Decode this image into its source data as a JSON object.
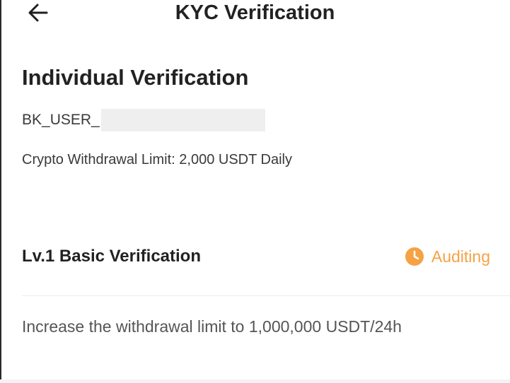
{
  "header": {
    "title": "KYC Verification",
    "back_icon": "arrow-left-icon"
  },
  "main": {
    "section_title": "Individual Verification",
    "user_id_prefix": "BK_USER_",
    "withdraw_limit": "Crypto Withdrawal Limit: 2,000 USDT Daily"
  },
  "level": {
    "title": "Lv.1 Basic Verification",
    "status": "Auditing",
    "status_icon": "clock-icon",
    "status_color": "#f5a245",
    "description": "Increase the withdrawal limit to 1,000,000 USDT/24h"
  }
}
